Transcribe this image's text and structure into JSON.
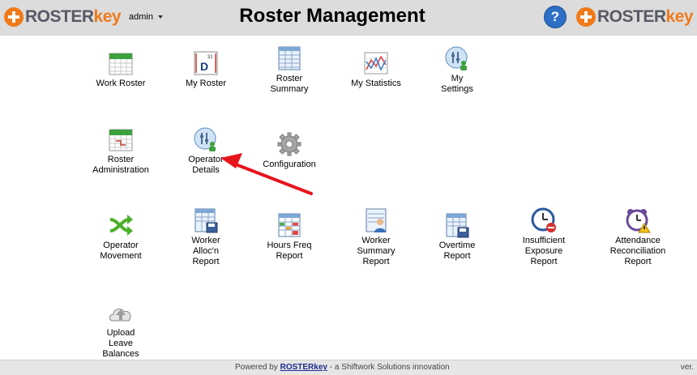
{
  "header": {
    "logo_left": {
      "brand_main": "ROSTER",
      "brand_accent": "key"
    },
    "logo_right": {
      "brand_main": "ROSTER",
      "brand_accent": "key"
    },
    "user": "admin",
    "title": "Roster Management",
    "help_icon": "?"
  },
  "tiles": [
    {
      "label": "Work Roster",
      "icon": "calendar-icon"
    },
    {
      "label": "My Roster",
      "icon": "day-calendar-icon",
      "day": "D",
      "date": "31"
    },
    {
      "label": "Roster\nSummary",
      "icon": "grid-icon"
    },
    {
      "label": "My Statistics",
      "icon": "line-chart-icon"
    },
    {
      "label": "My\nSettings",
      "icon": "user-settings-icon"
    },
    {
      "label": "Roster\nAdministration",
      "icon": "calendar-admin-icon"
    },
    {
      "label": "Operator\nDetails",
      "icon": "operator-icon"
    },
    {
      "label": "Configuration",
      "icon": "gear-icon"
    },
    {
      "label": "Operator\nMovement",
      "icon": "shuffle-icon"
    },
    {
      "label": "Worker\nAlloc'n\nReport",
      "icon": "report-save-icon"
    },
    {
      "label": "Hours Freq\nReport",
      "icon": "grid-color-icon"
    },
    {
      "label": "Worker\nSummary\nReport",
      "icon": "person-report-icon"
    },
    {
      "label": "Overtime\nReport",
      "icon": "report-save-icon"
    },
    {
      "label": "Insufficient\nExposure\nReport",
      "icon": "clock-stop-icon"
    },
    {
      "label": "Attendance\nReconciliation\nReport",
      "icon": "alarm-warning-icon"
    },
    {
      "label": "Upload\nLeave\nBalances",
      "icon": "cloud-upload-icon"
    }
  ],
  "footer": {
    "powered_by": "Powered by",
    "brand_main": "ROSTER",
    "brand_accent": "key",
    "tagline": "- a Shiftwork Solutions innovation",
    "version": "ver."
  },
  "colors": {
    "accent": "#f07a1a",
    "header_bg": "#dcdcdc",
    "arrow": "#e8141c",
    "help": "#2d6fc5"
  }
}
